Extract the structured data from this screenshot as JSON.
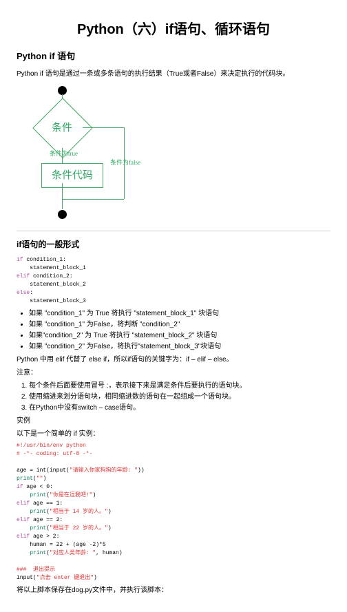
{
  "title": "Python（六）if语句、循环语句",
  "h2_if": "Python if 语句",
  "intro": "Python if 语句是通过一条或多条语句的执行结果（True或者False）来决定执行的代码块。",
  "flow": {
    "cond": "条件",
    "true_label": "条件为true",
    "false_label": "条件为false",
    "code_block": "条件代码"
  },
  "h3_form": "if语句的一般形式",
  "form_code": {
    "l1_kw": "if",
    "l1_txt": " condition_1:",
    "l2": "    statement_block_1",
    "l3_kw": "elif",
    "l3_txt": " condition_2:",
    "l4": "    statement_block_2",
    "l5_kw": "else",
    "l5_txt": ":",
    "l6": "    statement_block_3"
  },
  "bullets": [
    "如果 \"condition_1\" 为 True 将执行 \"statement_block_1\" 块语句",
    "如果 \"condition_1\" 为False，将判断 \"condition_2\"",
    "如果\"condition_2\" 为 True 将执行 \"statement_block_2\" 块语句",
    "如果 \"condition_2\" 为False，将执行\"statement_block_3\"块语句"
  ],
  "elif_note": "Python 中用 elif 代替了 else if，所以if语句的关键字为：if – elif – else。",
  "note_label": "注意：",
  "notes": [
    "每个条件后面要使用冒号 :，表示接下来是满足条件后要执行的语句块。",
    "使用缩进来划分语句块，相同缩进数的语句在一起组成一个语句块。",
    "在Python中没有switch – case语句。"
  ],
  "example_label": "实例",
  "example_intro": "以下是一个简单的 if 实例：",
  "code2": {
    "c1": "#!/usr/bin/env python",
    "c2": "# -*- coding: utf-8 -*-",
    "l1a": "age = int(input(",
    "l1s": "\"请输入你家狗狗的年龄: \"",
    "l1b": "))",
    "l2a": "print",
    "l2b": "(",
    "l2s": "\"\"",
    "l2c": ")",
    "l3kw": "if",
    "l3t": " age < 0:",
    "l4a": "    print",
    "l4b": "(",
    "l4s": "\"你是在逗我吧!\"",
    "l4c": ")",
    "l5kw": "elif",
    "l5t": " age == 1:",
    "l6a": "    print",
    "l6b": "(",
    "l6s": "\"相当于 14 岁的人。\"",
    "l6c": ")",
    "l7kw": "elif",
    "l7t": " age == 2:",
    "l8a": "    print",
    "l8b": "(",
    "l8s": "\"相当于 22 岁的人。\"",
    "l8c": ")",
    "l9kw": "elif",
    "l9t": " age > 2:",
    "l10": "    human = 22 + (age -2)*5",
    "l11a": "    print",
    "l11b": "(",
    "l11s": "\"对应人类年龄: \"",
    "l11c": ", human)",
    "blank": "",
    "l12c": "###  退出提示",
    "l13a": "input(",
    "l13s": "\"点击 enter 键退出\"",
    "l13b": ")"
  },
  "save_note": "将以上脚本保存在dog.py文件中，并执行该脚本："
}
